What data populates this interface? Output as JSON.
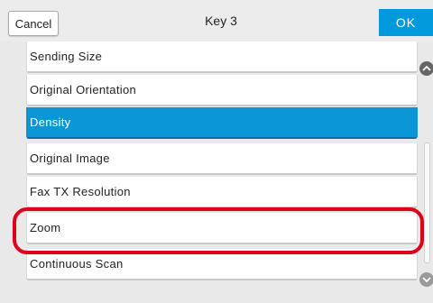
{
  "header": {
    "cancel_label": "Cancel",
    "title": "Key 3",
    "ok_label": "OK"
  },
  "list": {
    "items": [
      {
        "label": "Sending Size",
        "selected": false
      },
      {
        "label": "Original Orientation",
        "selected": false
      },
      {
        "label": "Density",
        "selected": true
      },
      {
        "label": "Original Image",
        "selected": false
      },
      {
        "label": "Fax TX Resolution",
        "selected": false
      },
      {
        "label": "Zoom",
        "selected": false
      },
      {
        "label": "Continuous Scan",
        "selected": false
      }
    ]
  },
  "scrollbar": {
    "up_icon": "chevron-up-icon",
    "down_icon": "chevron-down-icon"
  },
  "colors": {
    "accent": "#0099d9",
    "highlight_ring": "#e0001a"
  }
}
